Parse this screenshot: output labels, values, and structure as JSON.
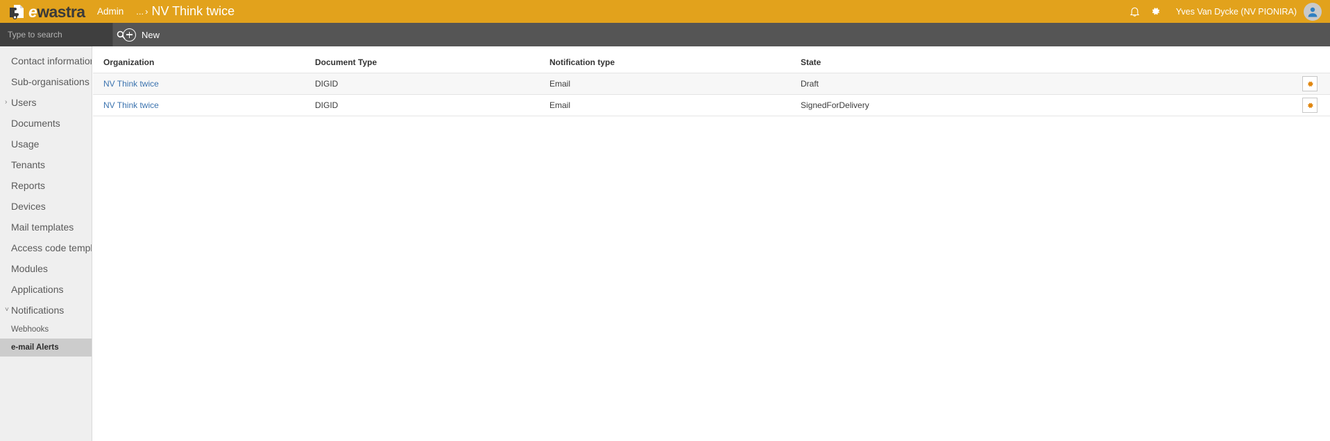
{
  "header": {
    "logo_text_first": "e",
    "logo_text_rest": "wastra",
    "logo_icon": "document-puzzle-logo-icon",
    "breadcrumb_root": "Admin",
    "breadcrumb_ellipsis": "...",
    "breadcrumb_separator": "›",
    "breadcrumb_current": "NV Think twice",
    "bell_icon": "bell-icon",
    "gear_icon": "gear-icon",
    "username": "Yves Van Dycke (NV PIONIRA)",
    "avatar_icon": "user-avatar-icon",
    "brand_color": "#e2a21c",
    "toolbar_color": "#555555"
  },
  "search": {
    "placeholder": "Type to search",
    "value": "",
    "icon": "search-icon"
  },
  "toolbar": {
    "new_label": "New",
    "new_icon": "plus-circle-icon"
  },
  "sidebar": {
    "items": [
      {
        "label": "Contact information",
        "expandable": false,
        "active": false,
        "sub": false
      },
      {
        "label": "Sub-organisations",
        "expandable": false,
        "active": false,
        "sub": false
      },
      {
        "label": "Users",
        "expandable": true,
        "chevron": "›",
        "active": false,
        "sub": false
      },
      {
        "label": "Documents",
        "expandable": false,
        "active": false,
        "sub": false
      },
      {
        "label": "Usage",
        "expandable": false,
        "active": false,
        "sub": false
      },
      {
        "label": "Tenants",
        "expandable": false,
        "active": false,
        "sub": false
      },
      {
        "label": "Reports",
        "expandable": false,
        "active": false,
        "sub": false
      },
      {
        "label": "Devices",
        "expandable": false,
        "active": false,
        "sub": false
      },
      {
        "label": "Mail templates",
        "expandable": false,
        "active": false,
        "sub": false
      },
      {
        "label": "Access code templ...",
        "expandable": false,
        "active": false,
        "sub": false
      },
      {
        "label": "Modules",
        "expandable": false,
        "active": false,
        "sub": false
      },
      {
        "label": "Applications",
        "expandable": false,
        "active": false,
        "sub": false
      },
      {
        "label": "Notifications",
        "expandable": true,
        "chevron": "˅",
        "active": false,
        "sub": false
      },
      {
        "label": "Webhooks",
        "expandable": false,
        "active": false,
        "sub": true
      },
      {
        "label": "e-mail Alerts",
        "expandable": false,
        "active": true,
        "sub": true
      }
    ]
  },
  "table": {
    "columns": [
      "Organization",
      "Document Type",
      "Notification type",
      "State"
    ],
    "rows": [
      {
        "organization": "NV Think twice",
        "document_type": "DIGID",
        "notification_type": "Email",
        "state": "Draft",
        "action_icon": "gear-icon"
      },
      {
        "organization": "NV Think twice",
        "document_type": "DIGID",
        "notification_type": "Email",
        "state": "SignedForDelivery",
        "action_icon": "gear-icon"
      }
    ]
  }
}
